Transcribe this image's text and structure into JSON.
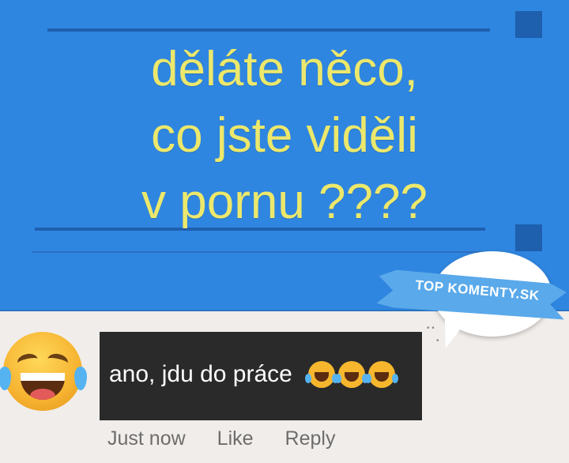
{
  "post": {
    "lines": [
      "děláte něco,",
      "co jste viděli",
      "v pornu ????"
    ],
    "text_color": "#ece86c",
    "background_color": "#2f86e0"
  },
  "watermark": {
    "label": "TOP KOMENTY.SK"
  },
  "comment": {
    "avatar_icon": "laughing-crying-emoji-icon",
    "text": "ano, jdu do práce",
    "trailing_emojis": [
      "rolling-on-floor-laughing-icon",
      "rolling-on-floor-laughing-icon",
      "rolling-on-floor-laughing-icon"
    ],
    "box_color": "#2a2a2a"
  },
  "actions": {
    "timestamp": "Just now",
    "like_label": "Like",
    "reply_label": "Reply"
  }
}
